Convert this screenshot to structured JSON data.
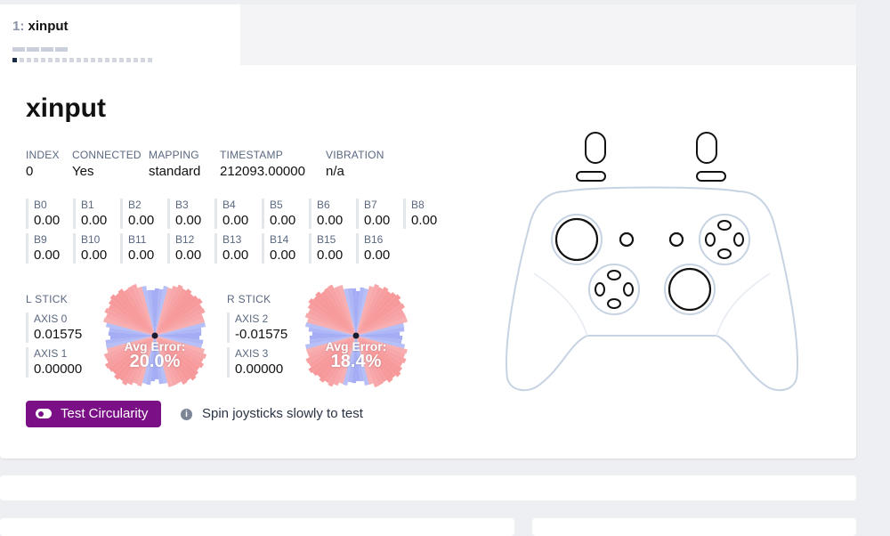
{
  "tab": {
    "number": "1:",
    "name": "xinput"
  },
  "gamepad": {
    "title": "xinput",
    "meta": [
      {
        "label": "INDEX",
        "value": "0"
      },
      {
        "label": "CONNECTED",
        "value": "Yes"
      },
      {
        "label": "MAPPING",
        "value": "standard"
      },
      {
        "label": "TIMESTAMP",
        "value": "212093.00000"
      },
      {
        "label": "VIBRATION",
        "value": "n/a"
      }
    ],
    "buttons": [
      {
        "label": "B0",
        "value": "0.00"
      },
      {
        "label": "B1",
        "value": "0.00"
      },
      {
        "label": "B2",
        "value": "0.00"
      },
      {
        "label": "B3",
        "value": "0.00"
      },
      {
        "label": "B4",
        "value": "0.00"
      },
      {
        "label": "B5",
        "value": "0.00"
      },
      {
        "label": "B6",
        "value": "0.00"
      },
      {
        "label": "B7",
        "value": "0.00"
      },
      {
        "label": "B8",
        "value": "0.00"
      },
      {
        "label": "B9",
        "value": "0.00"
      },
      {
        "label": "B10",
        "value": "0.00"
      },
      {
        "label": "B11",
        "value": "0.00"
      },
      {
        "label": "B12",
        "value": "0.00"
      },
      {
        "label": "B13",
        "value": "0.00"
      },
      {
        "label": "B14",
        "value": "0.00"
      },
      {
        "label": "B15",
        "value": "0.00"
      },
      {
        "label": "B16",
        "value": "0.00"
      }
    ],
    "left_stick": {
      "label": "L STICK",
      "axes": [
        {
          "label": "AXIS 0",
          "value": "0.01575"
        },
        {
          "label": "AXIS 1",
          "value": "0.00000"
        }
      ],
      "avg_error_label": "Avg Error:",
      "avg_error": "20.0%"
    },
    "right_stick": {
      "label": "R STICK",
      "axes": [
        {
          "label": "AXIS 2",
          "value": "-0.01575"
        },
        {
          "label": "AXIS 3",
          "value": "0.00000"
        }
      ],
      "avg_error_label": "Avg Error:",
      "avg_error": "18.4%"
    }
  },
  "actions": {
    "test_circularity": "Test Circularity",
    "hint": "Spin joysticks slowly to test",
    "hint_icon": "info-icon"
  },
  "colors": {
    "accent": "#7b0f86",
    "error_red": "#f47a7d",
    "error_blue": "#7f8cf0",
    "controller_outline": "#c7d3e3"
  }
}
